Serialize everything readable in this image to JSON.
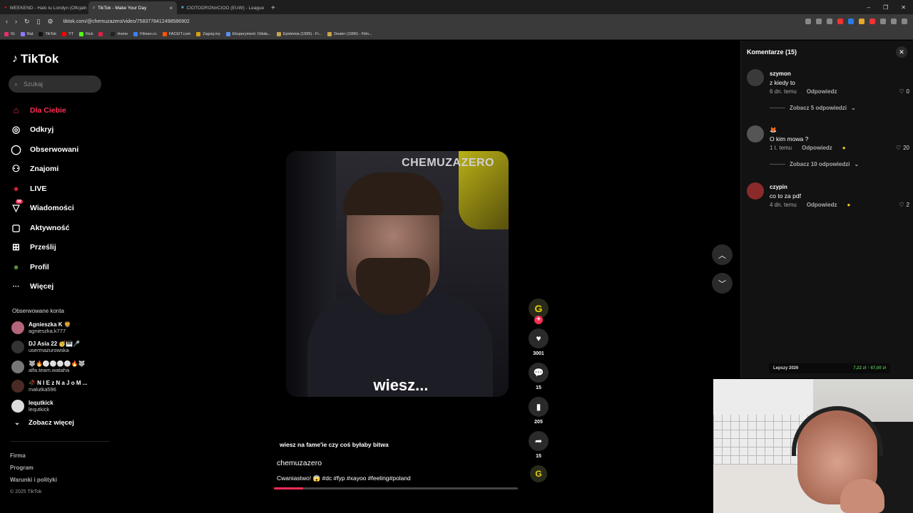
{
  "browser": {
    "tabs": [
      {
        "label": "WEEKEND - Halo tu Londyn (Oficjaln",
        "active": false
      },
      {
        "label": "TikTok - Make Your Day",
        "active": true
      },
      {
        "label": "CIOTODRON#CIOO (EUW) - League",
        "active": false
      }
    ],
    "url": "tiktok.com/@chemuzazero/video/7583778412498586902",
    "bookmarks": [
      "IG",
      "Rat",
      "TikTok",
      "YT",
      "Kick",
      "",
      "Home",
      "Filman.cc",
      "FACEIT.com",
      "Zagraj.my",
      "Eksperyment: Odsła...",
      "Epidemia (1995) - Fi...",
      "Dealer (1996) - Film..."
    ],
    "bookmark_colors": [
      "#e1306c",
      "#8a7cff",
      "#111111",
      "#ff0000",
      "#53fc18",
      "#e11d48",
      "#222222",
      "#3b82f6",
      "#ff5500",
      "#d4a017",
      "#5b8def",
      "#c8a24a",
      "#c8a24a"
    ]
  },
  "sidebar": {
    "logo": "TikTok",
    "search_placeholder": "Szukaj",
    "nav": [
      {
        "label": "Dla Ciebie",
        "icon": "home-icon",
        "glyph": "⌂"
      },
      {
        "label": "Odkryj",
        "icon": "compass-icon",
        "glyph": "◎"
      },
      {
        "label": "Obserwowani",
        "icon": "following-icon",
        "glyph": "◯"
      },
      {
        "label": "Znajomi",
        "icon": "friends-icon",
        "glyph": "⚇"
      },
      {
        "label": "LIVE",
        "icon": "live-icon",
        "glyph": "●"
      },
      {
        "label": "Wiadomości",
        "icon": "messages-icon",
        "glyph": "▽",
        "badge": "99"
      },
      {
        "label": "Aktywność",
        "icon": "activity-icon",
        "glyph": "▢"
      },
      {
        "label": "Prześlij",
        "icon": "upload-icon",
        "glyph": "⊞"
      },
      {
        "label": "Profil",
        "icon": "profile-icon",
        "glyph": "●"
      },
      {
        "label": "Więcej",
        "icon": "more-icon",
        "glyph": "···"
      }
    ],
    "following_title": "Obserwowane konta",
    "following": [
      {
        "name": "Agnieszka K 🦁",
        "user": "agnieszka.k777"
      },
      {
        "name": "DJ Asia 22 🥳🎹🎤",
        "user": "usermazurowska"
      },
      {
        "name": "🐺🔥⚪⚪⚪⚪🔥🐺",
        "user": "alfa.team.wataha"
      },
      {
        "name": "🥀 N I E z N a J o M ...",
        "user": "malutka596"
      },
      {
        "name": "lequtkick",
        "user": "lequtkick"
      }
    ],
    "see_more": "Zobacz więcej",
    "footer": [
      "Firma",
      "Program",
      "Warunki i polityki"
    ],
    "copyright": "© 2025 TikTok"
  },
  "video": {
    "watermark": "CHEMUZAZERO",
    "subtitle": "wiesz...",
    "caption_top": "wiesz na fame'ie czy coś byłaby bitwa",
    "author": "chemuzazero",
    "description": "Cwaniastwo! 😱 #dc #fyp #xayoo #feeling#poland",
    "progress": 0.12
  },
  "actions": {
    "likes": "3001",
    "comments": "15",
    "saves": "205",
    "shares": "15"
  },
  "comments_panel": {
    "title": "Komentarze (15)",
    "items": [
      {
        "user": "szymon",
        "text": "z kiedy to",
        "time": "6 dn. temu",
        "reply": "Odpowiedz",
        "likes": "0",
        "more": "Zobacz 5 odpowiedzi",
        "gift": false
      },
      {
        "user": "🦊",
        "text": "O kim mowa ?",
        "time": "1 t. temu",
        "reply": "Odpowiedz",
        "likes": "20",
        "more": "Zobacz 10 odpowiedzi",
        "gift": true
      },
      {
        "user": "czypin",
        "text": "co to za pdf",
        "time": "4 dn. temu",
        "reply": "Odpowiedz",
        "likes": "2",
        "more": "",
        "gift": true
      }
    ]
  },
  "overlay": {
    "price_label": "Lepszy 2026",
    "price_values": "7,22 zł  ↑  67,00 zł"
  }
}
